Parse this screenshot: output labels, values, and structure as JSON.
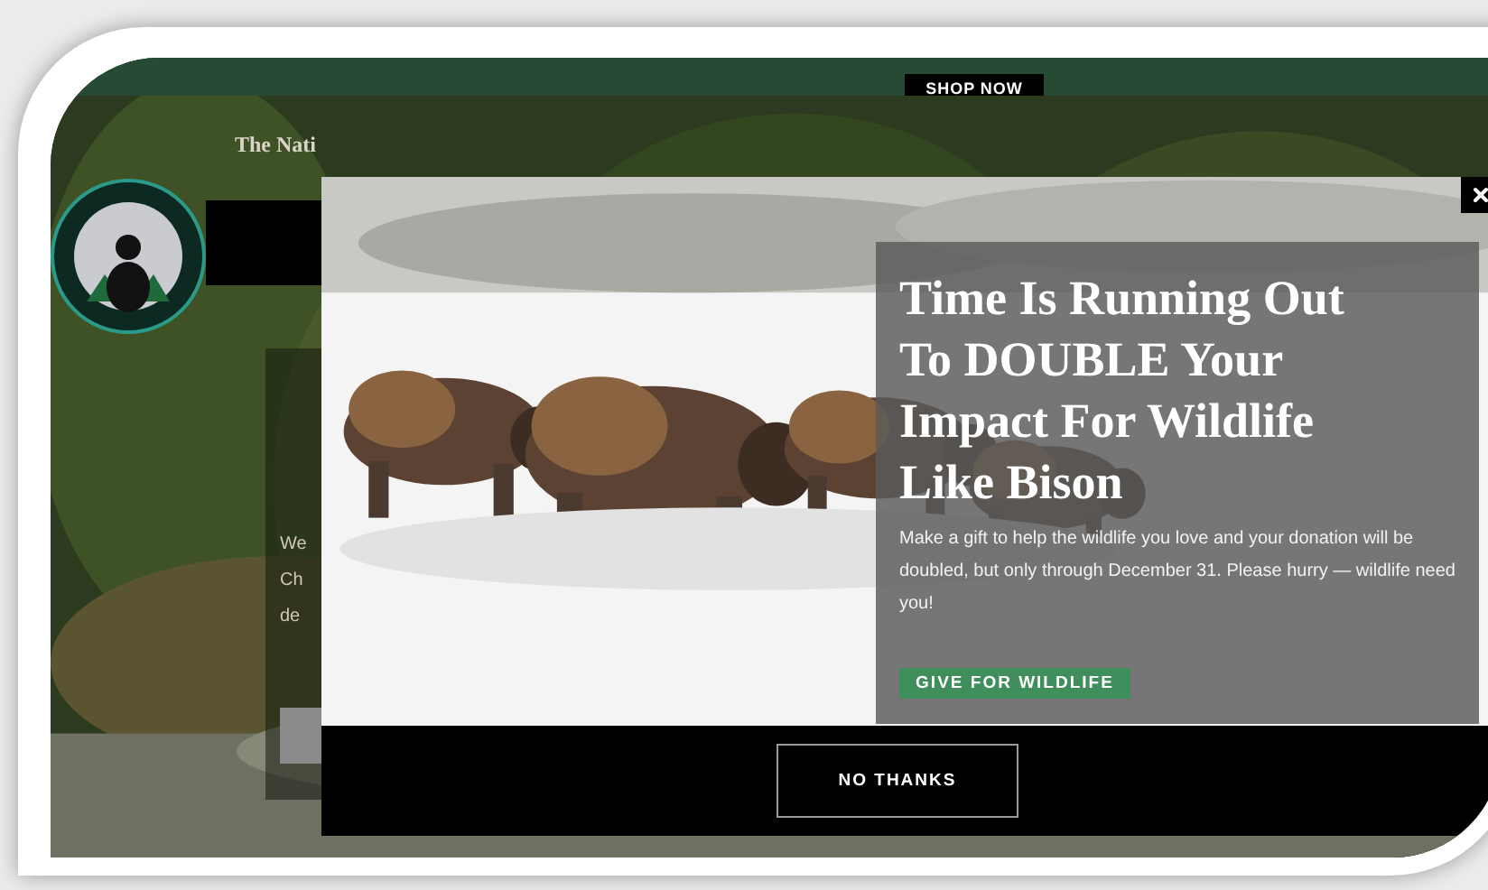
{
  "banner": {
    "button": "SHOP NOW"
  },
  "nav": {
    "text": "The Nati"
  },
  "hero": {
    "body_lines": [
      "We",
      "Ch",
      "de"
    ]
  },
  "modal": {
    "title": "Time Is Running Out To DOUBLE Your Impact For Wildlife Like Bison",
    "body": "Make a gift to help the wildlife you love and your donation will be doubled, but only through December 31. Please hurry — wildlife need you!",
    "primary_button": "GIVE FOR WILDLIFE",
    "dismiss_button": "NO THANKS"
  }
}
